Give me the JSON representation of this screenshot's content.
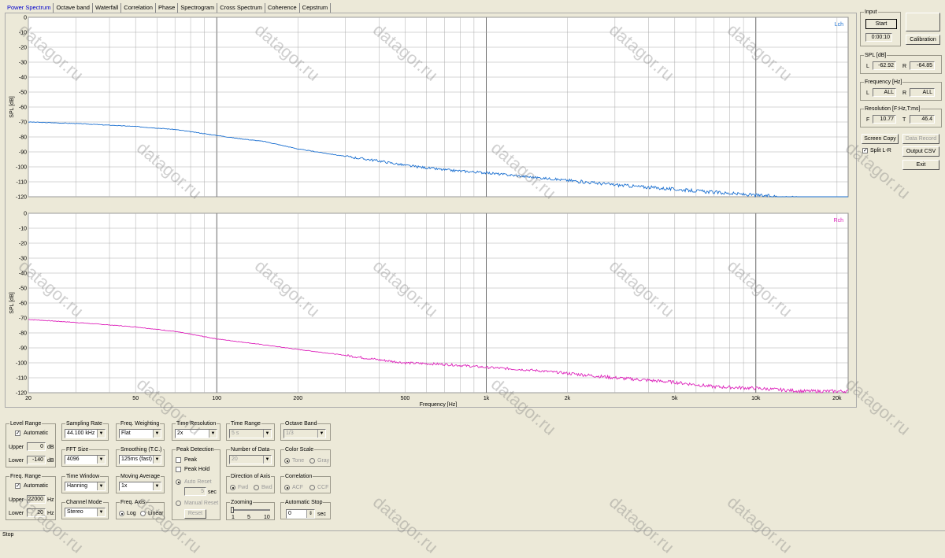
{
  "tabs": [
    "Power Spectrum",
    "Octave band",
    "Waterfall",
    "Correlation",
    "Phase",
    "Spectrogram",
    "Cross Spectrum",
    "Coherence",
    "Cepstrum"
  ],
  "active_tab": 0,
  "chart_data": [
    {
      "type": "line",
      "channel_label": "Lch",
      "ylabel": "SPL [dB]",
      "xlabel": "",
      "x_scale": "log",
      "xlim": [
        20,
        22000
      ],
      "ylim": [
        -120,
        0
      ],
      "y_ticks": [
        0,
        -10,
        -20,
        -30,
        -40,
        -50,
        -60,
        -70,
        -80,
        -90,
        -100,
        -110,
        -120
      ],
      "x_ticks": [],
      "color": "#1a6fd0",
      "series": [
        {
          "x": [
            20,
            30,
            50,
            70,
            100,
            120,
            150,
            200,
            300,
            400,
            500,
            700,
            1000,
            1500,
            2000,
            3000,
            5000,
            7000,
            10000,
            15000,
            20000
          ],
          "y": [
            -70,
            -71,
            -73,
            -75,
            -79,
            -81,
            -83,
            -88,
            -93,
            -96,
            -99,
            -102,
            -104,
            -107,
            -109,
            -112,
            -115,
            -117,
            -119,
            -121,
            -122
          ]
        }
      ]
    },
    {
      "type": "line",
      "channel_label": "Rch",
      "ylabel": "SPL [dB]",
      "xlabel": "Frequency [Hz]",
      "x_scale": "log",
      "xlim": [
        20,
        22000
      ],
      "ylim": [
        -120,
        0
      ],
      "y_ticks": [
        0,
        -10,
        -20,
        -30,
        -40,
        -50,
        -60,
        -70,
        -80,
        -90,
        -100,
        -110,
        -120
      ],
      "x_ticks": [
        "20",
        "50",
        "100",
        "200",
        "500",
        "1k",
        "2k",
        "5k",
        "10k",
        "20k"
      ],
      "color": "#dd22bb",
      "series": [
        {
          "x": [
            20,
            30,
            50,
            70,
            100,
            150,
            200,
            300,
            400,
            500,
            700,
            1000,
            1500,
            2000,
            3000,
            5000,
            7000,
            10000,
            15000,
            20000
          ],
          "y": [
            -71,
            -73,
            -76,
            -79,
            -84,
            -88,
            -91,
            -95,
            -98,
            -100,
            -101,
            -103,
            -105,
            -107,
            -110,
            -113,
            -116,
            -117,
            -119,
            -119
          ]
        }
      ]
    }
  ],
  "input": {
    "title": "Input",
    "start": "Start",
    "time": "0:00:10",
    "calibration": "Calibration"
  },
  "spl": {
    "title": "SPL [dB]",
    "l_label": "L",
    "l_value": "-62.92",
    "r_label": "R",
    "r_value": "-64.85"
  },
  "frequency": {
    "title": "Frequency [Hz]",
    "l_label": "L",
    "l_value": "ALL",
    "r_label": "R",
    "r_value": "ALL"
  },
  "resolution": {
    "title": "Resolution [F:Hz,T:ms]",
    "f_label": "F",
    "f_value": "10.77",
    "t_label": "T",
    "t_value": "46.4"
  },
  "buttons": {
    "screen_copy": "Screen Copy",
    "data_record": "Data Record",
    "output_csv": "Output CSV",
    "exit": "Exit",
    "split": "Split L-R"
  },
  "level_range": {
    "title": "Level Range",
    "auto": "Automatic",
    "upper_label": "Upper",
    "upper_value": "0",
    "upper_unit": "dB",
    "lower_label": "Lower",
    "lower_value": "-140",
    "lower_unit": "dB"
  },
  "freq_range": {
    "title": "Freq. Range",
    "auto": "Automatic",
    "upper_label": "Upper",
    "upper_value": "22000",
    "upper_unit": "Hz",
    "lower_label": "Lower",
    "lower_value": "20",
    "lower_unit": "Hz"
  },
  "sampling_rate": {
    "title": "Sampling Rate",
    "value": "44.100 kHz"
  },
  "fft_size": {
    "title": "FFT Size",
    "value": "4096"
  },
  "time_window": {
    "title": "Time Window",
    "value": "Hanning"
  },
  "channel_mode": {
    "title": "Channel Mode",
    "value": "Stereo"
  },
  "freq_weighting": {
    "title": "Freq. Weighting",
    "value": "Flat"
  },
  "smoothing": {
    "title": "Smoothing (T.C.)",
    "value": "125ms (fast)"
  },
  "moving_average": {
    "title": "Moving Average",
    "value": "1x"
  },
  "freq_axis": {
    "title": "Freq. Axis",
    "log": "Log",
    "linear": "Linear"
  },
  "time_resolution": {
    "title": "Time Resolution",
    "value": "2x"
  },
  "peak_detection": {
    "title": "Peak Detection",
    "peak": "Peak",
    "peak_hold": "Peak Hold",
    "auto_reset": "Auto Reset",
    "seconds_value": "5",
    "seconds_unit": "sec",
    "manual_reset": "Manual Reset",
    "reset": "Reset"
  },
  "time_range": {
    "title": "Time Range",
    "value": "5 s"
  },
  "number_of_data": {
    "title": "Number of Data",
    "value": "20"
  },
  "direction_axis": {
    "title": "Direction of Axis",
    "fwd": "Fwd",
    "bwd": "Bwd"
  },
  "zooming": {
    "title": "Zooming",
    "t1": "1",
    "t5": "5",
    "t10": "10"
  },
  "octave_band": {
    "title": "Octave Band",
    "value": "1/3"
  },
  "color_scale": {
    "title": "Color Scale",
    "tone": "Tone",
    "gray": "Gray"
  },
  "correlation": {
    "title": "Correlation",
    "acf": "ACF",
    "ccf": "CCF"
  },
  "auto_stop": {
    "title": "Automatic Stop",
    "value": "0",
    "unit": "sec"
  },
  "status": "Stop",
  "watermark": "datagor.ru"
}
